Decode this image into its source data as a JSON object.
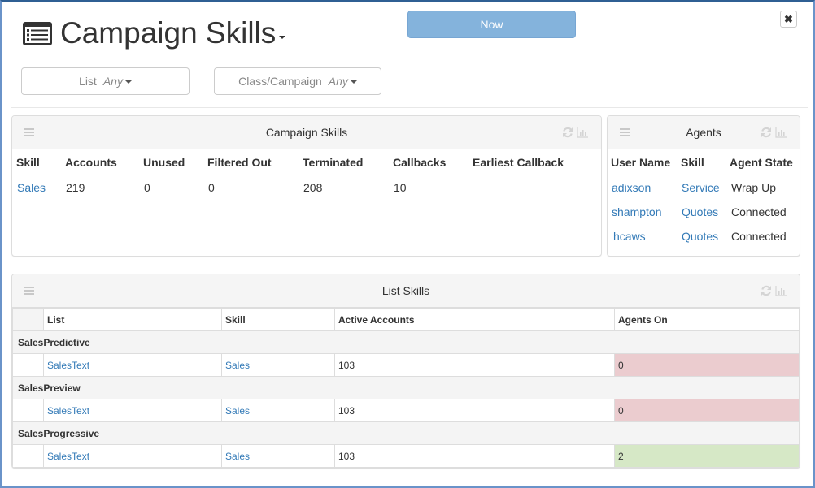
{
  "header": {
    "title": "Campaign Skills",
    "title_icon": "list-alt-icon",
    "now_label": "Now",
    "close_icon": "close-icon",
    "close_glyph": "✖"
  },
  "filters": [
    {
      "label": "List",
      "value": "Any"
    },
    {
      "label": "Class/Campaign",
      "value": "Any"
    }
  ],
  "campaign_skills": {
    "title": "Campaign Skills",
    "columns": [
      "Skill",
      "Accounts",
      "Unused",
      "Filtered Out",
      "Terminated",
      "Callbacks",
      "Earliest Callback"
    ],
    "rows": [
      {
        "skill": "Sales",
        "accounts": "219",
        "unused": "0",
        "filtered_out": "0",
        "terminated": "208",
        "callbacks": "10",
        "earliest_callback": ""
      }
    ]
  },
  "agents": {
    "title": "Agents",
    "columns": [
      "User Name",
      "Skill",
      "Agent State"
    ],
    "rows": [
      {
        "user": "adixson",
        "skill": "Service",
        "state": "Wrap Up"
      },
      {
        "user": "shampton",
        "skill": "Quotes",
        "state": "Connected"
      },
      {
        "user": "hcaws",
        "skill": "Quotes",
        "state": "Connected"
      }
    ]
  },
  "list_skills": {
    "title": "List Skills",
    "columns": [
      "",
      "List",
      "Skill",
      "Active Accounts",
      "Agents On"
    ],
    "groups": [
      {
        "name": "SalesPredictive",
        "rows": [
          {
            "list": "SalesText",
            "skill": "Sales",
            "active_accounts": "103",
            "agents_on": "0",
            "status": "bad"
          }
        ]
      },
      {
        "name": "SalesPreview",
        "rows": [
          {
            "list": "SalesText",
            "skill": "Sales",
            "active_accounts": "103",
            "agents_on": "0",
            "status": "bad"
          }
        ]
      },
      {
        "name": "SalesProgressive",
        "rows": [
          {
            "list": "SalesText",
            "skill": "Sales",
            "active_accounts": "103",
            "agents_on": "2",
            "status": "good"
          }
        ]
      }
    ]
  },
  "colors": {
    "accent": "#84b3dc",
    "link": "#337ab7",
    "bad_cell": "#ebcccf",
    "good_cell": "#d6e8c6"
  }
}
